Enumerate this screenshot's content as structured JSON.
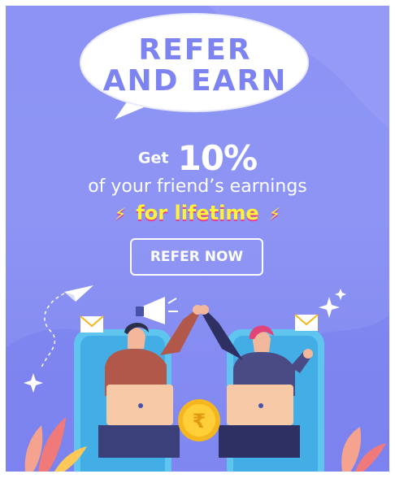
{
  "promo": {
    "headline_line1": "REFER",
    "headline_line2": "AND EARN",
    "get_label": "Get",
    "percent": "10%",
    "subtitle": "of your friend’s earnings",
    "highlight": "for lifetime",
    "button_label": "REFER NOW",
    "coin_symbol": "₹"
  },
  "colors": {
    "background": "#8c93f4",
    "headline": "#7d84f2",
    "highlight": "#fff23a",
    "highlight_shadow": "#e0409a",
    "coin": "#f5b71f"
  },
  "icons": [
    "speech-bubble-icon",
    "paper-plane-icon",
    "megaphone-icon",
    "envelope-icon",
    "sparkle-icon",
    "rupee-coin-icon",
    "laptop-icon"
  ]
}
